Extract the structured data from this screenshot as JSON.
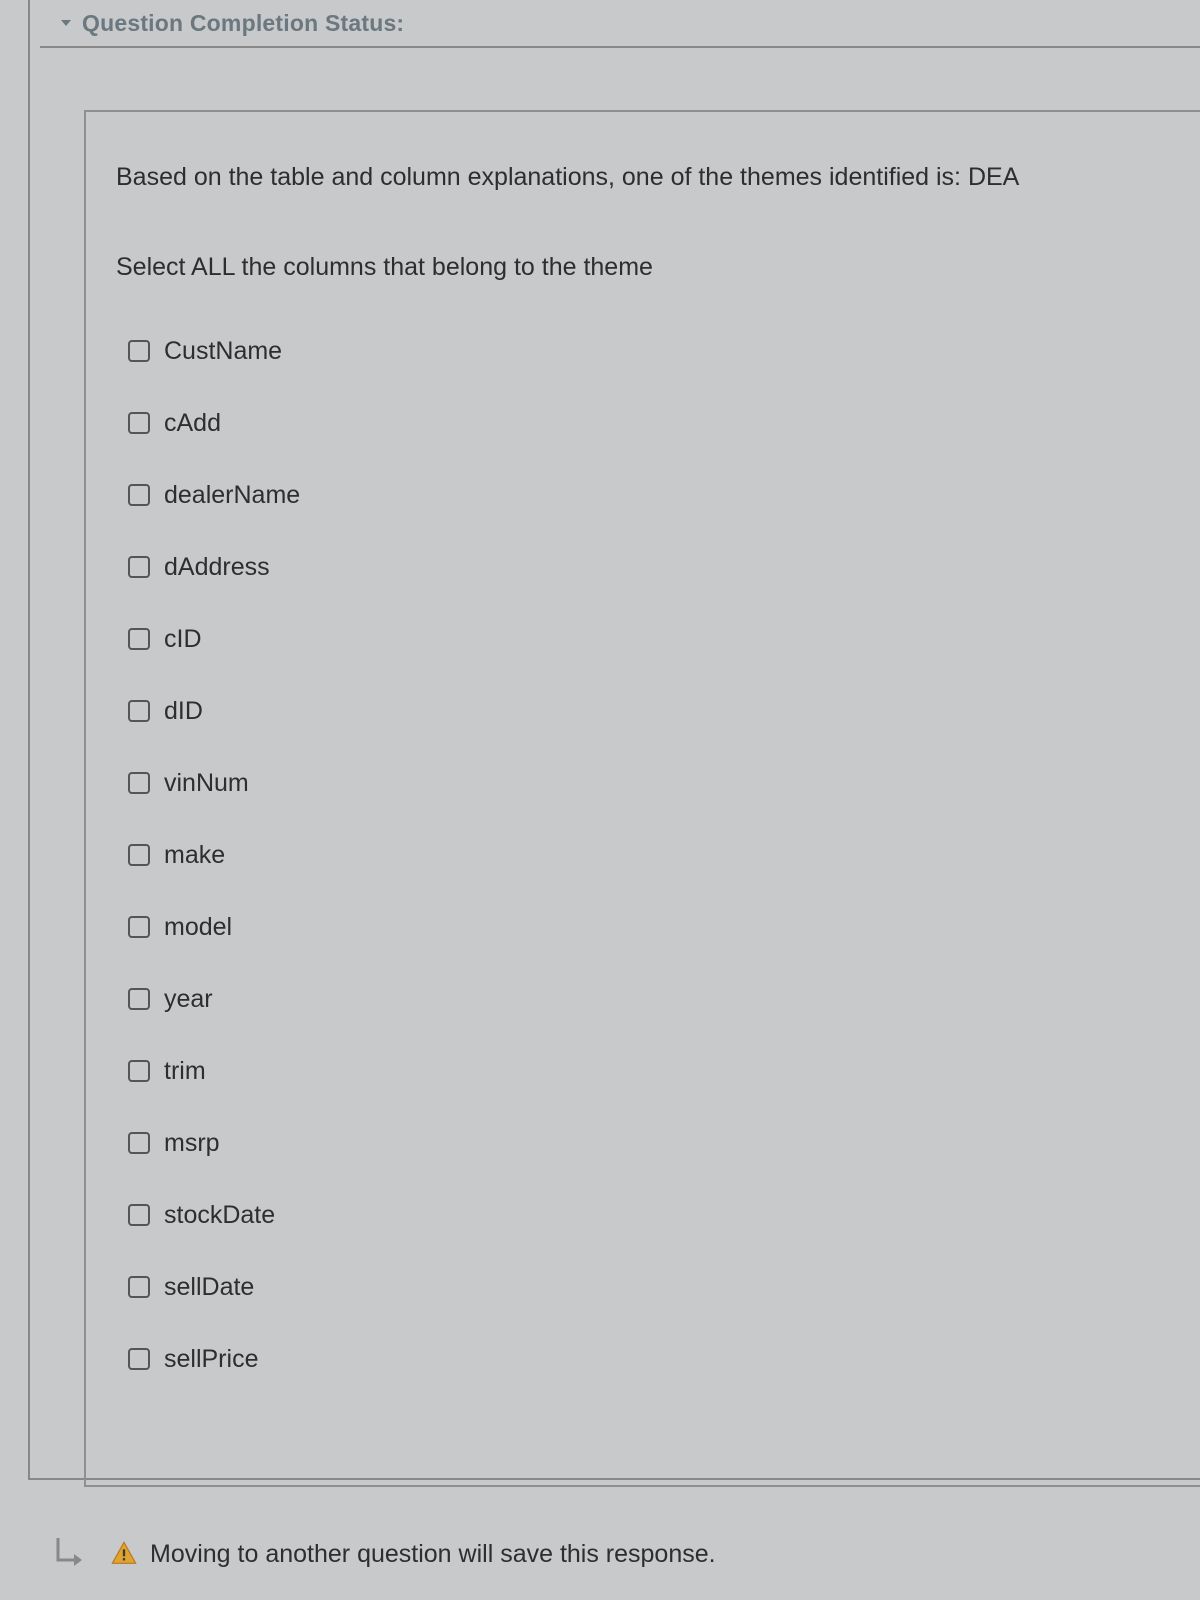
{
  "header": {
    "status_label": "Question Completion Status:"
  },
  "question": {
    "prompt": "Based on the table and column explanations, one of the themes identified is:  DEA",
    "instruction": "Select ALL the columns that belong to  the theme",
    "options": [
      {
        "label": "CustName"
      },
      {
        "label": "cAdd"
      },
      {
        "label": "dealerName"
      },
      {
        "label": "dAddress"
      },
      {
        "label": "cID"
      },
      {
        "label": "dID"
      },
      {
        "label": "vinNum"
      },
      {
        "label": "make"
      },
      {
        "label": "model"
      },
      {
        "label": "year"
      },
      {
        "label": "trim"
      },
      {
        "label": "msrp"
      },
      {
        "label": "stockDate"
      },
      {
        "label": "sellDate"
      },
      {
        "label": "sellPrice"
      }
    ]
  },
  "footer": {
    "message": "Moving to another question will save this response."
  }
}
